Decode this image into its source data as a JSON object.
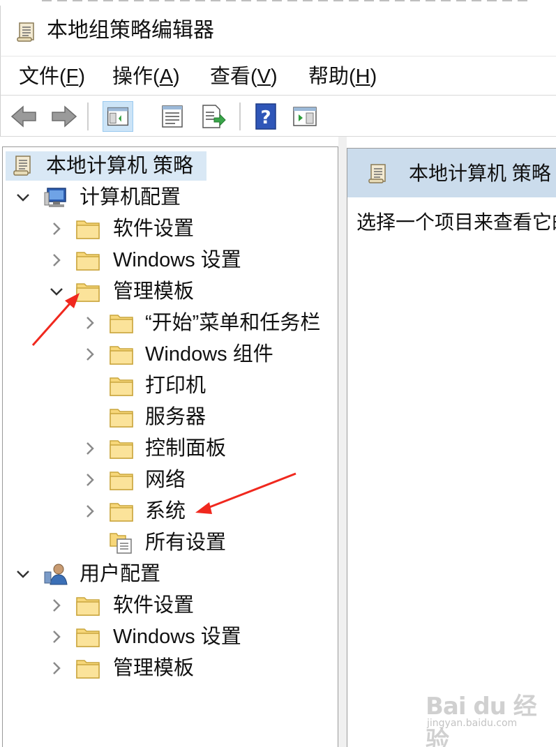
{
  "window": {
    "title": "本地组策略编辑器"
  },
  "menu": [
    {
      "label": "文件(",
      "key": "F",
      "tail": ")"
    },
    {
      "label": "操作(",
      "key": "A",
      "tail": ")"
    },
    {
      "label": "查看(",
      "key": "V",
      "tail": ")"
    },
    {
      "label": "帮助(",
      "key": "H",
      "tail": ")"
    }
  ],
  "toolbar": {
    "buttons": [
      "back-icon",
      "forward-icon",
      "show-hide-console-tree-icon",
      "properties-icon",
      "export-list-icon",
      "help-icon",
      "show-hide-action-pane-icon"
    ]
  },
  "tree": {
    "root": "本地计算机 策略",
    "computer_config": "计算机配置",
    "cc_software": "软件设置",
    "cc_windows": "Windows 设置",
    "cc_admin": "管理模板",
    "at_start": "“开始”菜单和任务栏",
    "at_wincomp": "Windows 组件",
    "at_printers": "打印机",
    "at_servers": "服务器",
    "at_control": "控制面板",
    "at_network": "网络",
    "at_system": "系统",
    "at_all": "所有设置",
    "user_config": "用户配置",
    "uc_software": "软件设置",
    "uc_windows": "Windows 设置",
    "uc_admin": "管理模板"
  },
  "right_pane": {
    "header": "本地计算机 策略",
    "description": "选择一个项目来查看它的描述。"
  },
  "watermark": {
    "logo": "Bai du 经验",
    "sub": "jingyan.baidu.com"
  },
  "colors": {
    "selection": "#d9e8f5",
    "header_bg": "#cbdcec",
    "folder": "#f7d77a",
    "arrow": "#f0281e"
  }
}
